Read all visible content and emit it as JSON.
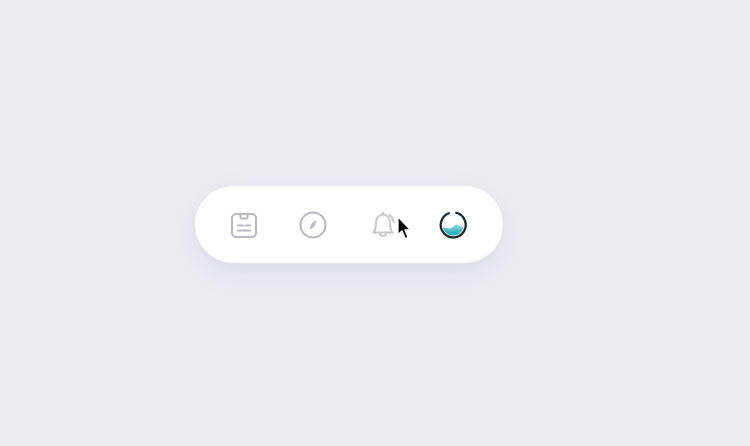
{
  "colors": {
    "background": "#ebebf0",
    "bar": "#ffffff",
    "icon_inactive": "#b8b8c0",
    "avatar_ring": "#1f2a30",
    "avatar_water": "#2fb3bf",
    "avatar_water_light": "#8ad8e0",
    "cursor": "#000000"
  },
  "nav": {
    "items": [
      {
        "icon": "notes-icon",
        "state": "inactive"
      },
      {
        "icon": "compass-icon",
        "state": "inactive"
      },
      {
        "icon": "bell-icon",
        "state": "hovered"
      },
      {
        "icon": "avatar-icon",
        "state": "active"
      }
    ]
  },
  "cursor": {
    "icon": "mouse-pointer-icon"
  }
}
